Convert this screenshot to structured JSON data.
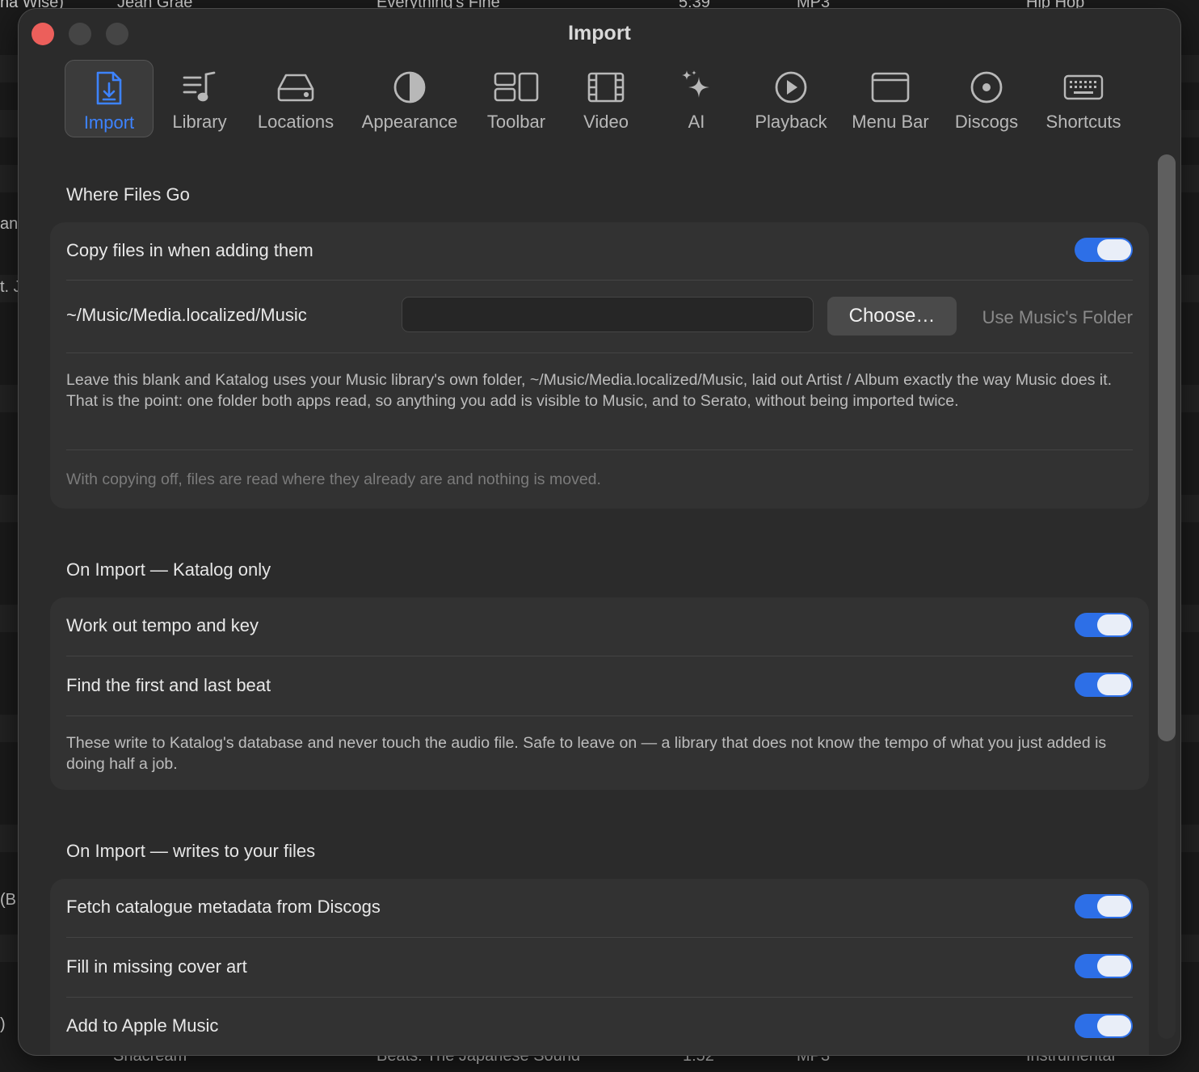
{
  "background": {
    "top_row": [
      "na Wise)",
      "Jean Grae",
      "Everything's Fine",
      "5:39",
      "MP3",
      "Hip Hop"
    ],
    "side_fragments": [
      "an",
      "t. J",
      "(B",
      ")"
    ],
    "bottom_row": [
      "Shacream",
      "Beats: The Japanese Sound",
      "1:52",
      "MP3",
      "Instrumental"
    ]
  },
  "window": {
    "title": "Import"
  },
  "toolbar": {
    "items": [
      {
        "label": "Import",
        "icon": "import-file-icon"
      },
      {
        "label": "Library",
        "icon": "music-note-list-icon"
      },
      {
        "label": "Locations",
        "icon": "drive-icon"
      },
      {
        "label": "Appearance",
        "icon": "half-circle-icon"
      },
      {
        "label": "Toolbar",
        "icon": "toolbar-layout-icon"
      },
      {
        "label": "Video",
        "icon": "film-icon"
      },
      {
        "label": "AI",
        "icon": "sparkles-icon"
      },
      {
        "label": "Playback",
        "icon": "play-circle-icon"
      },
      {
        "label": "Menu Bar",
        "icon": "menubar-window-icon"
      },
      {
        "label": "Discogs",
        "icon": "record-icon"
      },
      {
        "label": "Shortcuts",
        "icon": "keyboard-icon"
      }
    ],
    "active": "Import"
  },
  "where_files_go": {
    "title": "Where Files Go",
    "copy_files_label": "Copy files in when adding them",
    "copy_files_on": true,
    "path_label": "~/Music/Media.localized/Music",
    "path_value": "",
    "choose_label": "Choose…",
    "use_music_folder_label": "Use Music's Folder",
    "description": "Leave this blank and Katalog uses your Music library's own folder, ~/Music/Media.localized/Music, laid out Artist / Album exactly the way Music does it. That is the point: one folder both apps read, so anything you add is visible to Music, and to Serato, without being imported twice.",
    "note": "With copying off, files are read where they already are and nothing is moved."
  },
  "katalog_only": {
    "title": "On Import — Katalog only",
    "rows": [
      {
        "label": "Work out tempo and key",
        "on": true
      },
      {
        "label": "Find the first and last beat",
        "on": true
      }
    ],
    "description": "These write to Katalog's database and never touch the audio file. Safe to leave on — a library that does not know the tempo of what you just added is doing half a job."
  },
  "writes_files": {
    "title": "On Import — writes to your files",
    "rows": [
      {
        "label": "Fetch catalogue metadata from Discogs",
        "on": true
      },
      {
        "label": "Fill in missing cover art",
        "on": true
      },
      {
        "label": "Add to Apple Music",
        "on": true
      }
    ]
  },
  "colors": {
    "accent": "#3d83ff",
    "toggle_on": "#2d6fe7",
    "window_bg": "#2b2b2b",
    "card_bg": "#323232"
  }
}
